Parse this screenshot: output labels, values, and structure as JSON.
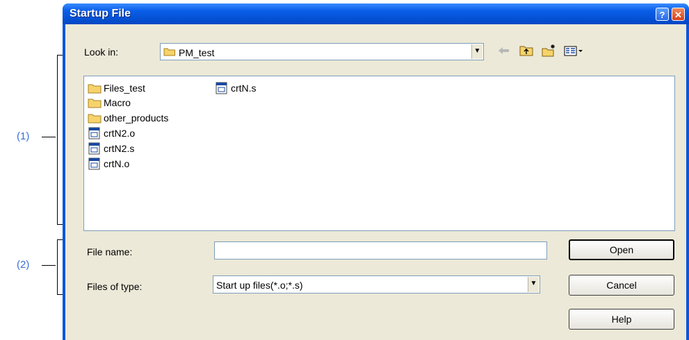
{
  "annotations": {
    "callout_1": "(1)",
    "callout_2": "(2)"
  },
  "window": {
    "title": "Startup File",
    "help_button": "?",
    "close_button": "✕"
  },
  "look_in": {
    "label": "Look in:",
    "value": "PM_test"
  },
  "toolbar": {
    "icons": [
      "back-arrow-icon",
      "up-folder-icon",
      "new-folder-icon",
      "view-menu-icon"
    ]
  },
  "files": [
    {
      "name": "Files_test",
      "type": "folder"
    },
    {
      "name": "Macro",
      "type": "folder"
    },
    {
      "name": "other_products",
      "type": "folder"
    },
    {
      "name": "crtN2.o",
      "type": "file"
    },
    {
      "name": "crtN2.s",
      "type": "file"
    },
    {
      "name": "crtN.o",
      "type": "file"
    },
    {
      "name": "crtN.s",
      "type": "file"
    }
  ],
  "file_name": {
    "label": "File name:",
    "value": ""
  },
  "file_type": {
    "label": "Files of type:",
    "value": "Start up files(*.o;*.s)"
  },
  "buttons": {
    "open": "Open",
    "cancel": "Cancel",
    "help": "Help"
  },
  "colors": {
    "title_bar": "#0552d6",
    "dialog_bg": "#ece9d8",
    "callout": "#3a6fd8"
  }
}
